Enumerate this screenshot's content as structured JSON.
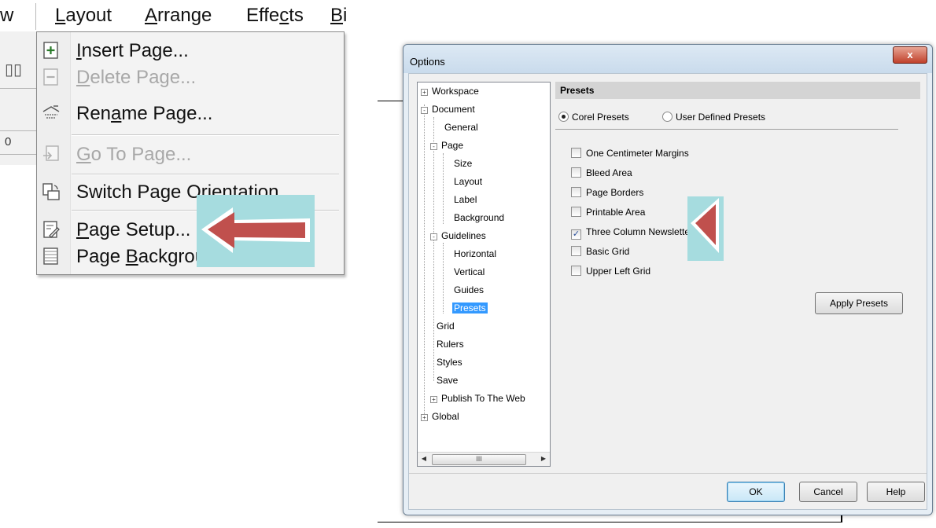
{
  "menubar": {
    "items": [
      {
        "label": "w"
      },
      {
        "label": "Layout",
        "mnemonic_label": "L",
        "rest": "ayout"
      },
      {
        "label": "Arrange",
        "mnemonic_label": "A",
        "rest": "rrange"
      },
      {
        "label": "Effects",
        "pre": "Effe",
        "mnemonic_label": "c",
        "rest": "ts"
      },
      {
        "label": "Bi",
        "mnemonic_label": "B",
        "rest": "i"
      }
    ]
  },
  "toolbar": {
    "ruler_zero": "0"
  },
  "layout_menu": {
    "items": [
      {
        "pre": "",
        "mn": "I",
        "post": "nsert Page...",
        "icon": "insert-page-icon",
        "enabled": true
      },
      {
        "pre": "",
        "mn": "D",
        "post": "elete Page...",
        "icon": "delete-page-icon",
        "enabled": false
      },
      {
        "pre": "Ren",
        "mn": "a",
        "post": "me Page...",
        "icon": "rename-page-icon",
        "enabled": true
      },
      {
        "pre": "",
        "mn": "G",
        "post": "o To Page...",
        "icon": "go-to-page-icon",
        "enabled": false
      },
      {
        "pre": "Switch Page Orientation",
        "mn": "",
        "post": "",
        "icon": "switch-orientation-icon",
        "enabled": true
      },
      {
        "pre": "",
        "mn": "P",
        "post": "age Setup...",
        "icon": "page-setup-icon",
        "enabled": true
      },
      {
        "pre": "Page ",
        "mn": "B",
        "post": "ackgrou",
        "icon": "page-background-icon",
        "enabled": true
      }
    ]
  },
  "dialog": {
    "title": "Options",
    "close_label": "x",
    "tree": [
      {
        "label": "Workspace",
        "expander": "+"
      },
      {
        "label": "Document",
        "expander": "-"
      },
      {
        "label": "General"
      },
      {
        "label": "Page",
        "expander": "-"
      },
      {
        "label": "Size"
      },
      {
        "label": "Layout"
      },
      {
        "label": "Label"
      },
      {
        "label": "Background"
      },
      {
        "label": "Guidelines",
        "expander": "-"
      },
      {
        "label": "Horizontal"
      },
      {
        "label": "Vertical"
      },
      {
        "label": "Guides"
      },
      {
        "label": "Presets",
        "selected": true
      },
      {
        "label": "Grid"
      },
      {
        "label": "Rulers"
      },
      {
        "label": "Styles"
      },
      {
        "label": "Save"
      },
      {
        "label": "Publish To The Web",
        "expander": "+"
      },
      {
        "label": "Global",
        "expander": "+"
      }
    ],
    "scroll": {
      "left": "◀",
      "right": "▶",
      "thumb": "III"
    },
    "section_title": "Presets",
    "radios": [
      {
        "label": "Corel Presets",
        "selected": true
      },
      {
        "label": "User Defined Presets",
        "selected": false
      }
    ],
    "checkboxes": [
      {
        "label": "One Centimeter Margins",
        "checked": false
      },
      {
        "label": "Bleed Area",
        "checked": false
      },
      {
        "label": "Page Borders",
        "checked": false
      },
      {
        "label": "Printable Area",
        "checked": false
      },
      {
        "label": "Three Column Newsletter",
        "checked": true
      },
      {
        "label": "Basic Grid",
        "checked": false
      },
      {
        "label": "Upper Left Grid",
        "checked": false
      }
    ],
    "apply_label": "Apply Presets",
    "buttons": {
      "ok": "OK",
      "cancel": "Cancel",
      "help": "Help"
    }
  },
  "colors": {
    "highlight": "#a6dcdf",
    "arrow": "#c0504d",
    "selection": "#3399ff"
  }
}
